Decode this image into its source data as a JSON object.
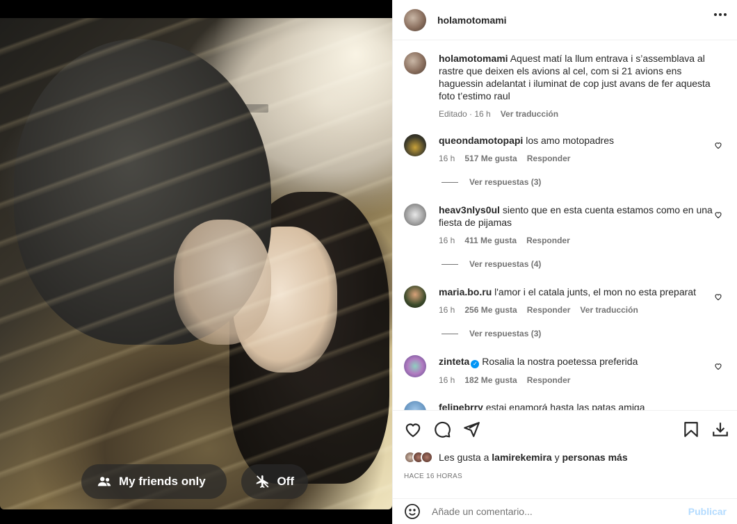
{
  "post": {
    "username": "holamotomami",
    "friends_pill": "My friends only",
    "off_pill": "Off"
  },
  "caption": {
    "username": "holamotomami",
    "text": "Aquest matí la llum entrava i s’assemblava al rastre que deixen els avions al cel, com si 21 avions ens haguessin adelantat i iluminat de cop just avans de fer aquesta foto t’estimo raul",
    "meta_edited": "Editado · 16 h",
    "meta_translate": "Ver traducción"
  },
  "comments": [
    {
      "username": "queondamotopapi",
      "text": "los amo motopadres",
      "time": "16 h",
      "likes": "517 Me gusta",
      "reply": "Responder",
      "translate": "",
      "view_replies": "Ver respuestas (3)"
    },
    {
      "username": "heav3nlys0ul",
      "text": "siento que en esta cuenta estamos como en una fiesta de pijamas",
      "time": "16 h",
      "likes": "411 Me gusta",
      "reply": "Responder",
      "translate": "",
      "view_replies": "Ver respuestas (4)"
    },
    {
      "username": "maria.bo.ru",
      "text": "l'amor i el catala junts, el mon no esta preparat",
      "time": "16 h",
      "likes": "256 Me gusta",
      "reply": "Responder",
      "translate": "Ver traducción",
      "view_replies": "Ver respuestas (3)"
    },
    {
      "username": "zinteta",
      "text": "Rosalia la nostra poetessa preferida",
      "time": "16 h",
      "likes": "182 Me gusta",
      "reply": "Responder",
      "translate": "",
      "view_replies": ""
    },
    {
      "username": "felipebrry",
      "text": "estai enamorá hasta las patas amiga",
      "time": "",
      "likes": "",
      "reply": "",
      "translate": "",
      "view_replies": ""
    }
  ],
  "likes_line": {
    "prefix": "Les gusta a",
    "user": "lamirekemira",
    "and": "y",
    "others": "personas más"
  },
  "timestamp": "HACE 16 HORAS",
  "add_comment": {
    "placeholder": "Añade un comentario...",
    "publish": "Publicar"
  },
  "colors": {
    "accent": "#0095f6",
    "publish_disabled": "#b3dbff",
    "text": "#262626",
    "muted": "#737373"
  }
}
